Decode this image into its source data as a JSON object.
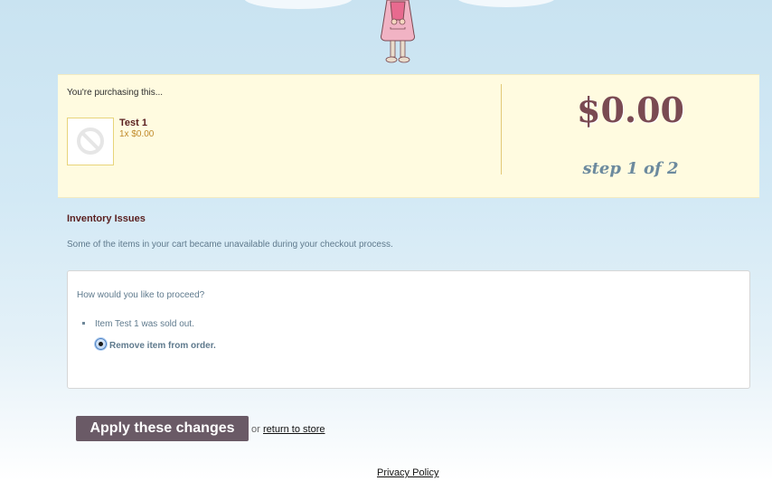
{
  "summary": {
    "purchasing_label": "You're purchasing this...",
    "item": {
      "name": "Test 1",
      "quantity_price": "1x $0.00"
    },
    "total": "$0.00",
    "step": "step 1 of 2"
  },
  "inventory": {
    "title": "Inventory Issues",
    "description": "Some of the items in your cart became unavailable during your checkout process.",
    "question": "How would you like to proceed?",
    "issues": [
      {
        "text": "Item Test 1 was sold out.",
        "option_label": "Remove item from order.",
        "selected": true
      }
    ]
  },
  "actions": {
    "apply_label": "Apply these changes",
    "or_text": "or",
    "return_label": "return to store"
  },
  "footer": {
    "privacy_label": "Privacy Policy"
  },
  "colors": {
    "summary_bg": "#fffbe0",
    "price": "#7a4a52",
    "step": "#6c8a9e",
    "heading": "#5a1f1f",
    "button_bg": "#6a5a66"
  },
  "icons": {
    "thumbnail": "no-image-icon",
    "mascot": "girl-with-doll-mascot"
  }
}
